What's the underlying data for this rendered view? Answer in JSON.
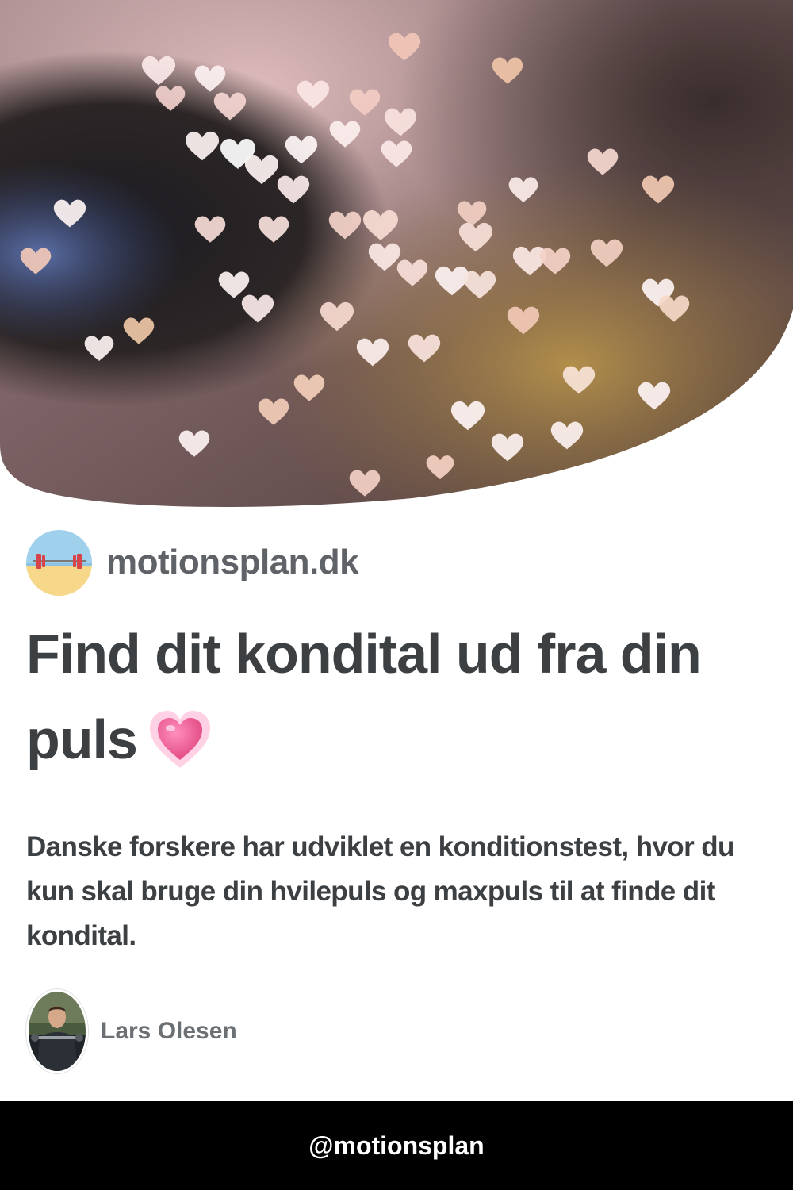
{
  "hero": {
    "icon": "bokeh-hearts-photo"
  },
  "site": {
    "logo_icon": "weightlifting-beach-icon",
    "name": "motionsplan.dk"
  },
  "article": {
    "title": "Find dit kondital ud fra din puls",
    "title_emoji": "growing-heart-icon",
    "description": "Danske forskere har udviklet en konditionstest, hvor du kun skal bruge din hvilepuls og maxpuls til at finde dit kondital."
  },
  "author": {
    "avatar_icon": "author-photo",
    "name": "Lars Olesen"
  },
  "footer": {
    "handle": "@motionsplan"
  },
  "colors": {
    "text": "#3c4043",
    "muted": "#5f6368",
    "footer_bg": "#000000",
    "heart_pink": "#f06a9b"
  }
}
